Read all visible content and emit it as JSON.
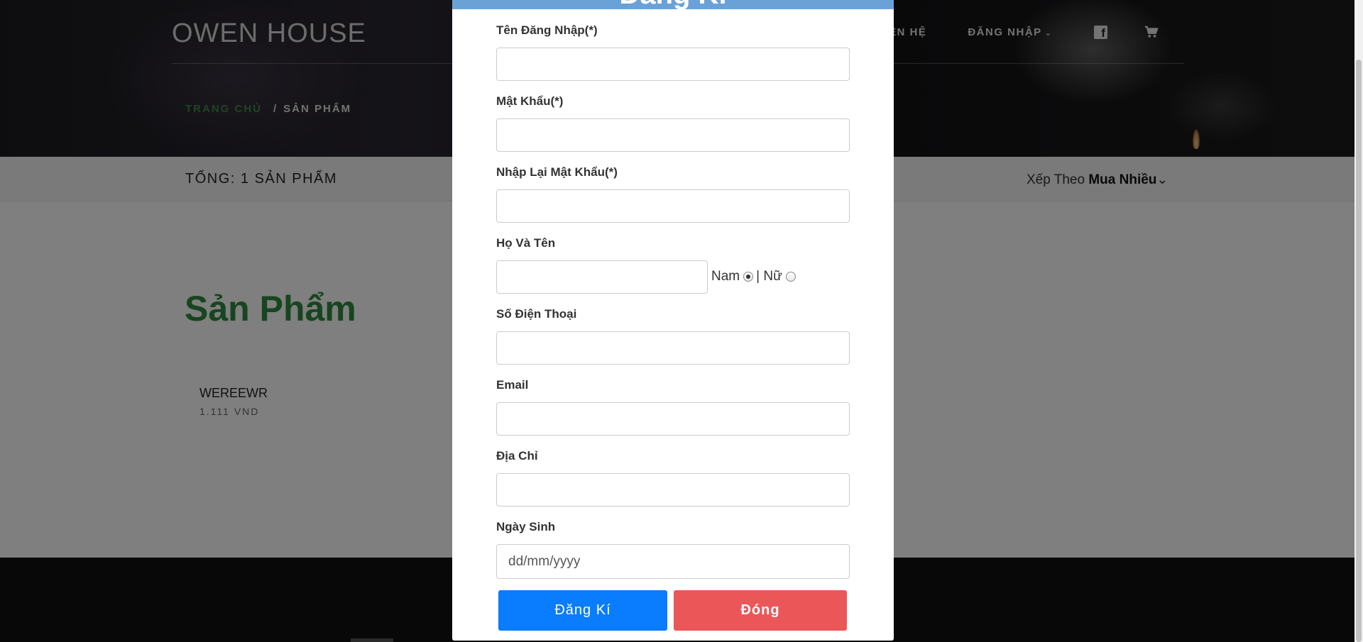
{
  "nav": {
    "brand": "OWEN HOUSE",
    "contact": "ÊN HỆ",
    "login": "ĐĂNG NHẬP",
    "icons": [
      "facebook-icon",
      "cart-icon"
    ]
  },
  "breadcrumb": {
    "home": "TRANG CHỦ",
    "separator": "/",
    "current": "SẢN PHẨM"
  },
  "toolbar": {
    "total": "TỔNG: 1 SẢN PHẨM",
    "sort_prefix": "Xếp Theo",
    "sort_value": "Mua Nhiều"
  },
  "content": {
    "heading": "Sản Phẩm",
    "products": [
      {
        "name": "WEREEWR",
        "price": "1.111 VND"
      }
    ]
  },
  "modal": {
    "title": "Đăng Kí",
    "fields": {
      "username_label": "Tên Đăng Nhập(*)",
      "password_label": "Mật Khẩu(*)",
      "confirm_label": "Nhập Lại Mật Khẩu(*)",
      "fullname_label": "Họ Và Tên",
      "gender_male": "Nam",
      "gender_sep": "|",
      "gender_female": "Nữ",
      "phone_label": "Số Điện Thoại",
      "email_label": "Email",
      "address_label": "Địa Chỉ",
      "birthday_label": "Ngày Sinh",
      "birthday_placeholder": "dd/mm/yyyy"
    },
    "values": {
      "username": "",
      "password": "",
      "confirm": "",
      "fullname": "",
      "phone": "",
      "email": "",
      "address": "",
      "birthday": ""
    },
    "gender_selected": "Nam",
    "register_button": "Đăng Kí",
    "close_button": "Đóng"
  },
  "colors": {
    "modal_header": "#6aa2d8",
    "register": "#0a7cfe",
    "close": "#eb5759",
    "heading_green": "#2e8b3e"
  }
}
